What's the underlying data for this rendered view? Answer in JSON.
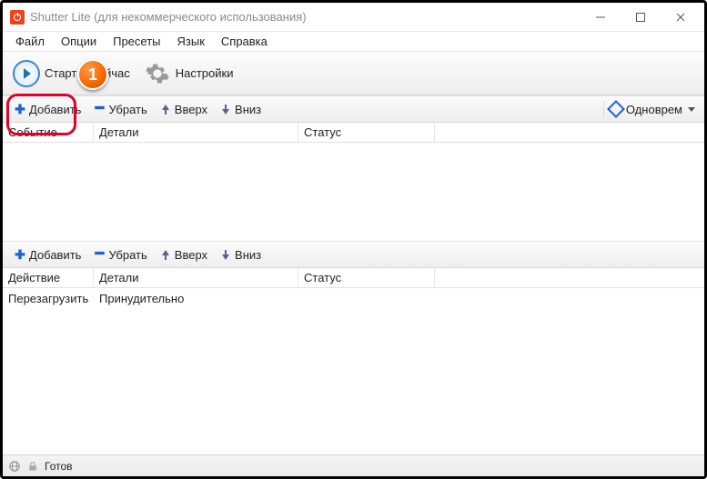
{
  "title": "Shutter Lite (для некоммерческого использования)",
  "menubar": [
    "Файл",
    "Опции",
    "Пресеты",
    "Язык",
    "Справка"
  ],
  "toolbar": {
    "start": "Старт",
    "now": "Сейчас",
    "settings": "Настройки"
  },
  "subbar": {
    "add": "Добавить",
    "remove": "Убрать",
    "up": "Вверх",
    "down": "Вниз",
    "mode": "Одноврем"
  },
  "events": {
    "headers": [
      "Событие",
      "Детали",
      "Статус"
    ],
    "rows": []
  },
  "actions": {
    "headers": [
      "Действие",
      "Детали",
      "Статус"
    ],
    "rows": [
      {
        "action": "Перезагрузить",
        "details": "Принудительно",
        "status": ""
      }
    ]
  },
  "status": "Готов",
  "annotation": {
    "badge": "1"
  }
}
